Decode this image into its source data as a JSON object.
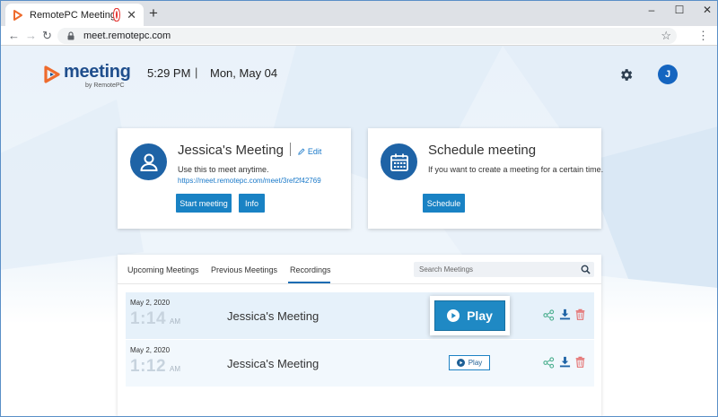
{
  "browser": {
    "tab_title": "RemotePC Meeting",
    "tab_close": "✕",
    "new_tab": "+",
    "url": "meet.remotepc.com",
    "window_controls": [
      "–",
      "☐",
      "✕"
    ]
  },
  "header": {
    "logo_word": "meeting",
    "logo_byline": "by RemotePC",
    "time": "5:29 PM",
    "separator": "|",
    "date": "Mon, May 04",
    "avatar_initial": "J"
  },
  "meeting_card": {
    "title": "Jessica's Meeting",
    "edit_label": "Edit",
    "description": "Use this to meet anytime.",
    "link": "https://meet.remotepc.com/meet/3ref2f42769",
    "start_button": "Start meeting",
    "info_button": "Info"
  },
  "schedule_card": {
    "title": "Schedule meeting",
    "description": "If you want to create a meeting for a certain time.",
    "schedule_button": "Schedule"
  },
  "tabs": {
    "items": [
      "Upcoming Meetings",
      "Previous Meetings",
      "Recordings"
    ],
    "active": "Recordings",
    "search_placeholder": "Search Meetings"
  },
  "recordings": [
    {
      "date": "May 2, 2020",
      "time": "1:14",
      "ampm": "AM",
      "name": "Jessica's Meeting",
      "play_label": "Play"
    },
    {
      "date": "May 2, 2020",
      "time": "1:12",
      "ampm": "AM",
      "name": "Jessica's Meeting",
      "play_label": "Play"
    }
  ],
  "colors": {
    "brand_blue": "#1982c4",
    "dark_blue": "#1e63a6",
    "logo_orange": "#ee6b2d",
    "share_green": "#4caf8f",
    "delete_red": "#e57373"
  }
}
